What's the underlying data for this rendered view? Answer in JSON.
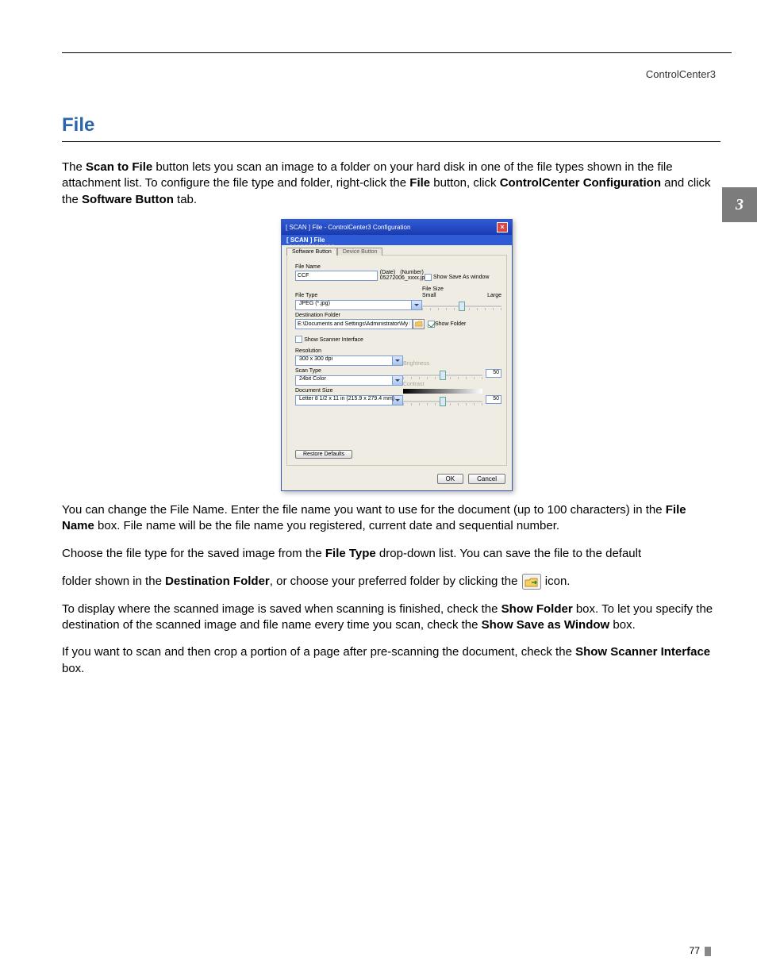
{
  "doc": {
    "header": "ControlCenter3",
    "side_tab": "3",
    "h1": "File",
    "page_number": "77"
  },
  "para1": {
    "t1": "The ",
    "b1": "Scan to File",
    "t2": " button lets you scan an image to a folder on your hard disk in one of the file types shown in the file attachment list. To configure the file type and folder, right-click the ",
    "b2": "File",
    "t3": " button, click ",
    "b3": "ControlCenter Configuration",
    "t4": " and click the ",
    "b4": "Software Button",
    "t5": " tab."
  },
  "dialog": {
    "title": "[ SCAN ]  File - ControlCenter3 Configuration",
    "close": "×",
    "subtitle": "[ SCAN ]  File",
    "tab_active": "Software Button",
    "tab_inactive": "Device Button",
    "labels": {
      "file_name": "File Name",
      "date": "(Date)",
      "number": "(Number)",
      "date_value": "05272006_xxxx.jpg",
      "show_save_as": "Show Save As window",
      "file_type": "File Type",
      "file_size": "File Size",
      "small": "Small",
      "large": "Large",
      "dest_folder": "Destination Folder",
      "show_folder": "Show Folder",
      "show_scanner": "Show Scanner Interface",
      "resolution": "Resolution",
      "brightness": "Brightness",
      "scan_type": "Scan Type",
      "contrast": "Contrast",
      "doc_size": "Document Size",
      "restore": "Restore Defaults",
      "ok": "OK",
      "cancel": "Cancel"
    },
    "values": {
      "file_name": "CCF",
      "file_type": "JPEG (*.jpg)",
      "dest_folder": "E:\\Documents and Settings\\Administrator\\My Docume",
      "resolution": "300 x 300 dpi",
      "scan_type": "24bit Color",
      "doc_size": "Letter 8 1/2 x 11 in (215.9 x 279.4 mm)",
      "brightness": "50",
      "contrast": "50"
    }
  },
  "para2": {
    "t1": "You can change the File Name. Enter the file name you want to use for the document (up to 100 characters) in the ",
    "b1": "File Name",
    "t2": " box. File name will be the file name you registered, current date and sequential number."
  },
  "para3": {
    "t1": "Choose the file type for the saved image from the ",
    "b1": "File Type",
    "t2": " drop-down list. You can save the file to the default"
  },
  "para4": {
    "t1": "folder shown in the ",
    "b1": "Destination Folder",
    "t2": ", or choose your preferred folder by clicking the ",
    "t3": " icon."
  },
  "para5": {
    "t1": "To display where the scanned image is saved when scanning is finished, check the ",
    "b1": "Show Folder",
    "t2": " box. To let you specify the destination of the scanned image and file name every time you scan, check the ",
    "b2": "Show Save as Window",
    "t3": " box."
  },
  "para6": {
    "t1": "If you want to scan and then crop a portion of a page after pre-scanning the document, check the ",
    "b1": "Show Scanner Interface",
    "t2": " box."
  }
}
